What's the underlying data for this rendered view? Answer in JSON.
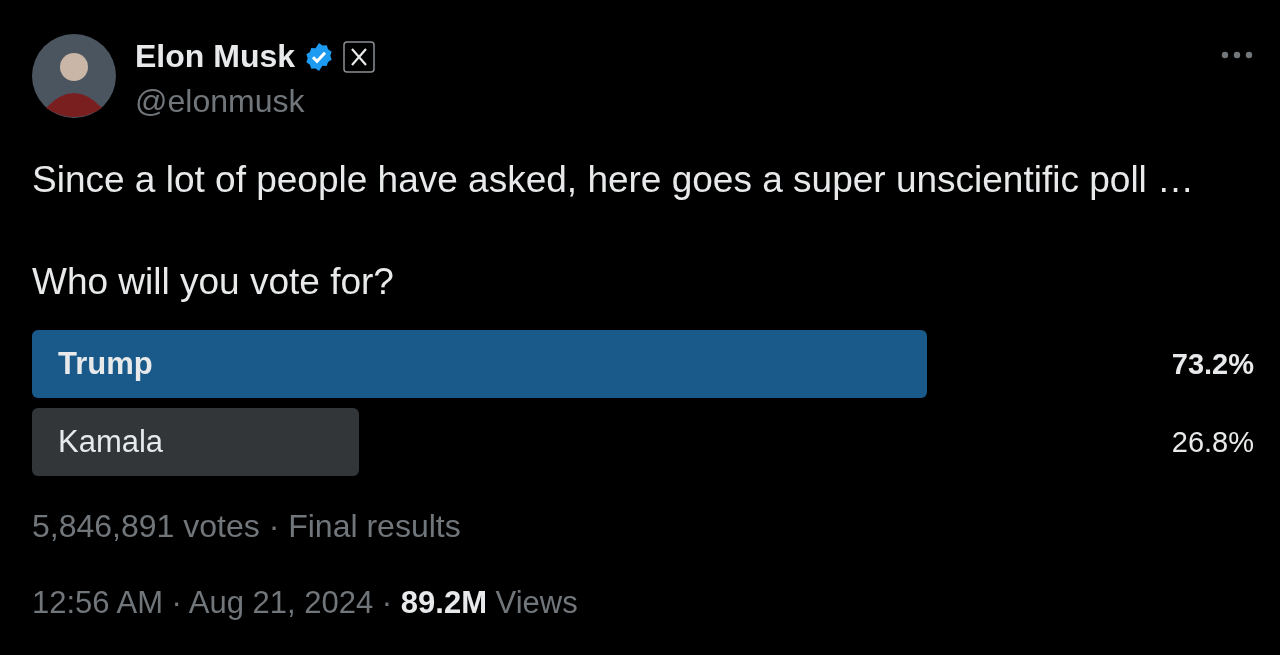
{
  "author": {
    "name": "Elon Musk",
    "verified": true,
    "handle": "@elonmusk"
  },
  "tweet": {
    "paragraphs": [
      "Since a lot of people have asked, here goes a super unscientific poll …",
      "Who will you vote for?"
    ]
  },
  "poll": {
    "options": [
      {
        "label": "Trump",
        "percent": "73.2%",
        "leading": true
      },
      {
        "label": "Kamala",
        "percent": "26.8%",
        "leading": false
      }
    ],
    "summary": "5,846,891 votes · Final results"
  },
  "footer": "12:56 AM · Aug 21, 2024 · **89.2M** Views"
}
